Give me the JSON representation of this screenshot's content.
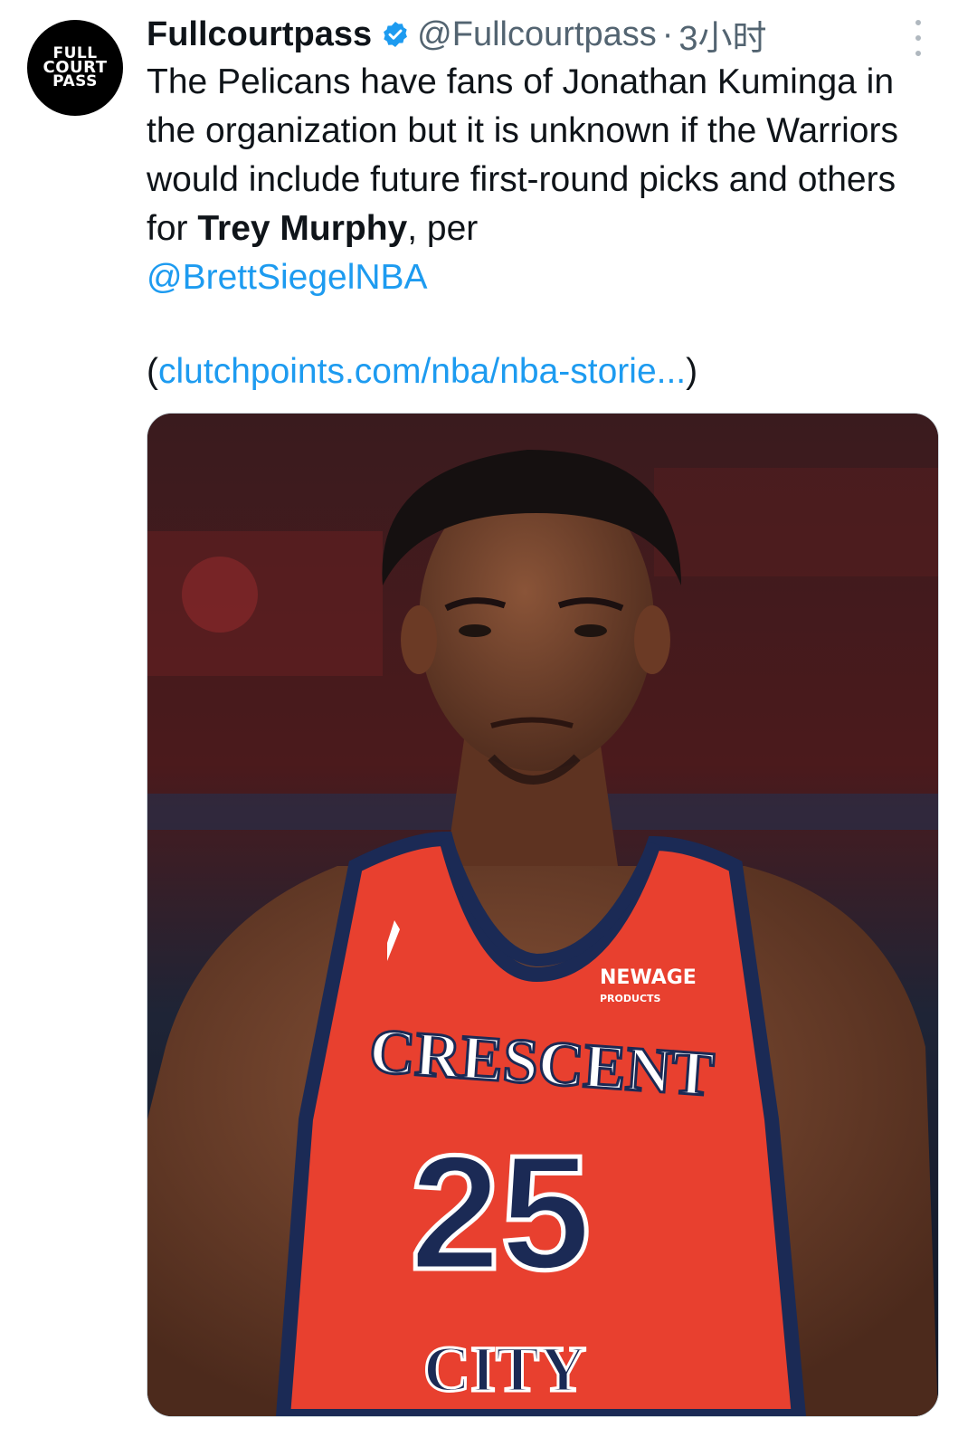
{
  "tweet": {
    "display_name": "Fullcourtpass",
    "handle": "@Fullcourtpass",
    "separator": "·",
    "time": "3小时",
    "avatar_text": [
      "FULL",
      "COURT",
      "PASS"
    ],
    "text_part1": "The Pelicans have fans of Jonathan Kuminga in the organization but it is unknown if the Warriors would include future first-round picks and others for ",
    "text_bold": "Trey Murphy",
    "text_part2": ", per ",
    "mention": "@BrettSiegelNBA",
    "link_open": "(",
    "link": "clutchpoints.com/nba/nba-storie...",
    "link_close": ")",
    "media": {
      "jersey_sponsor_line1": "NEWAGE",
      "jersey_sponsor_line2": "PRODUCTS",
      "jersey_word_top": "CRESCENT",
      "jersey_number": "25",
      "jersey_word_bottom": "CITY"
    }
  },
  "colors": {
    "link": "#1d9bf0",
    "secondary_text": "#536471",
    "verified_badge": "#1d9bf0",
    "jersey_red": "#e8402f",
    "jersey_navy": "#1b2a55"
  },
  "icons": [
    "verified-badge-icon",
    "more-options-icon"
  ]
}
